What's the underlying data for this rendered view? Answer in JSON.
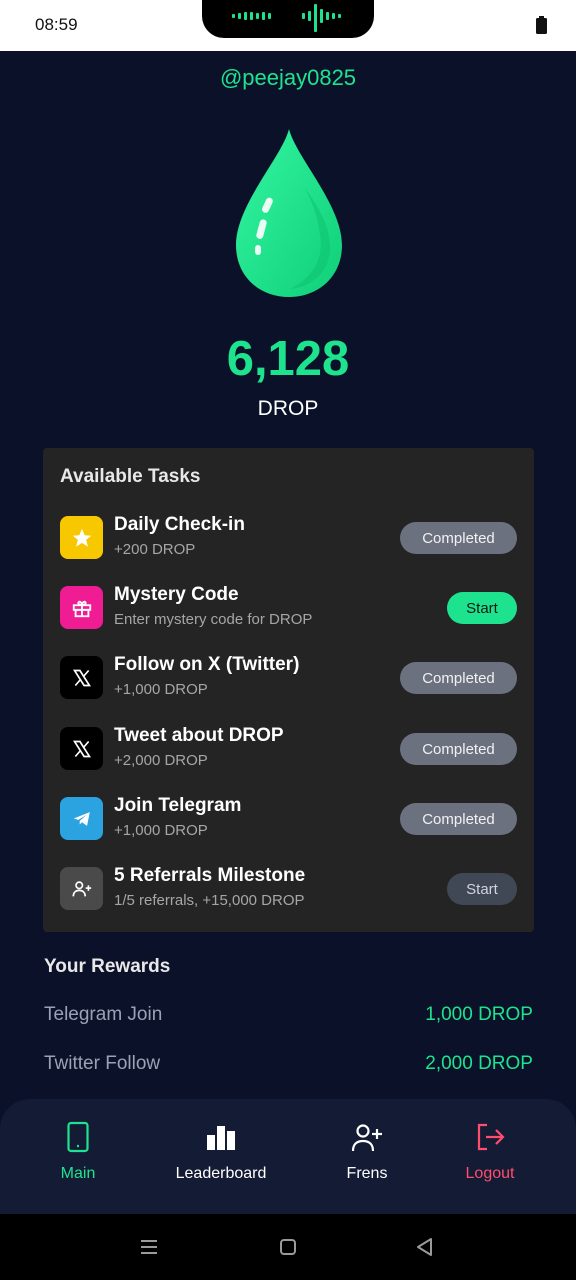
{
  "status_bar": {
    "time": "08:59",
    "battery_icon": "battery-icon"
  },
  "profile": {
    "username": "@peejay0825",
    "balance": "6,128",
    "unit": "DROP",
    "icon": "drop-icon"
  },
  "tasks": {
    "title": "Available Tasks",
    "items": [
      {
        "name": "Daily Check-in",
        "desc": "+200 DROP",
        "button": "Completed",
        "state": "completed",
        "icon": "star-icon",
        "icon_color": "#f7c800"
      },
      {
        "name": "Mystery Code",
        "desc": "Enter mystery code for DROP",
        "button": "Start",
        "state": "start-active",
        "icon": "gift-icon",
        "icon_color": "#f01c94"
      },
      {
        "name": "Follow on X (Twitter)",
        "desc": "+1,000 DROP",
        "button": "Completed",
        "state": "completed",
        "icon": "x-logo-icon",
        "icon_color": "#000000"
      },
      {
        "name": "Tweet about DROP",
        "desc": "+2,000 DROP",
        "button": "Completed",
        "state": "completed",
        "icon": "x-logo-icon",
        "icon_color": "#000000"
      },
      {
        "name": "Join Telegram",
        "desc": "+1,000 DROP",
        "button": "Completed",
        "state": "completed",
        "icon": "telegram-icon",
        "icon_color": "#2aa3e0"
      },
      {
        "name": "5 Referrals Milestone",
        "desc": "1/5 referrals, +15,000 DROP",
        "button": "Start",
        "state": "start-muted",
        "icon": "user-plus-icon",
        "icon_color": "#4a4a4a"
      }
    ]
  },
  "rewards": {
    "title": "Your Rewards",
    "items": [
      {
        "name": "Telegram Join",
        "amount": "1,000 DROP"
      },
      {
        "name": "Twitter Follow",
        "amount": "2,000 DROP"
      }
    ]
  },
  "bottom_nav": {
    "items": [
      {
        "label": "Main",
        "icon": "phone-icon",
        "active": true,
        "color": "#1ee38e"
      },
      {
        "label": "Leaderboard",
        "icon": "bar-chart-icon",
        "active": false,
        "color": "#ffffff"
      },
      {
        "label": "Frens",
        "icon": "user-plus-icon",
        "active": false,
        "color": "#ffffff"
      },
      {
        "label": "Logout",
        "icon": "logout-icon",
        "active": false,
        "color": "#ff4d6d"
      }
    ]
  },
  "system_nav": {
    "icons": [
      "menu-icon",
      "home-square-icon",
      "back-triangle-icon"
    ]
  },
  "colors": {
    "accent": "#1ee38e",
    "background": "#0b1128",
    "card": "#242424",
    "danger": "#ff4d6d"
  }
}
